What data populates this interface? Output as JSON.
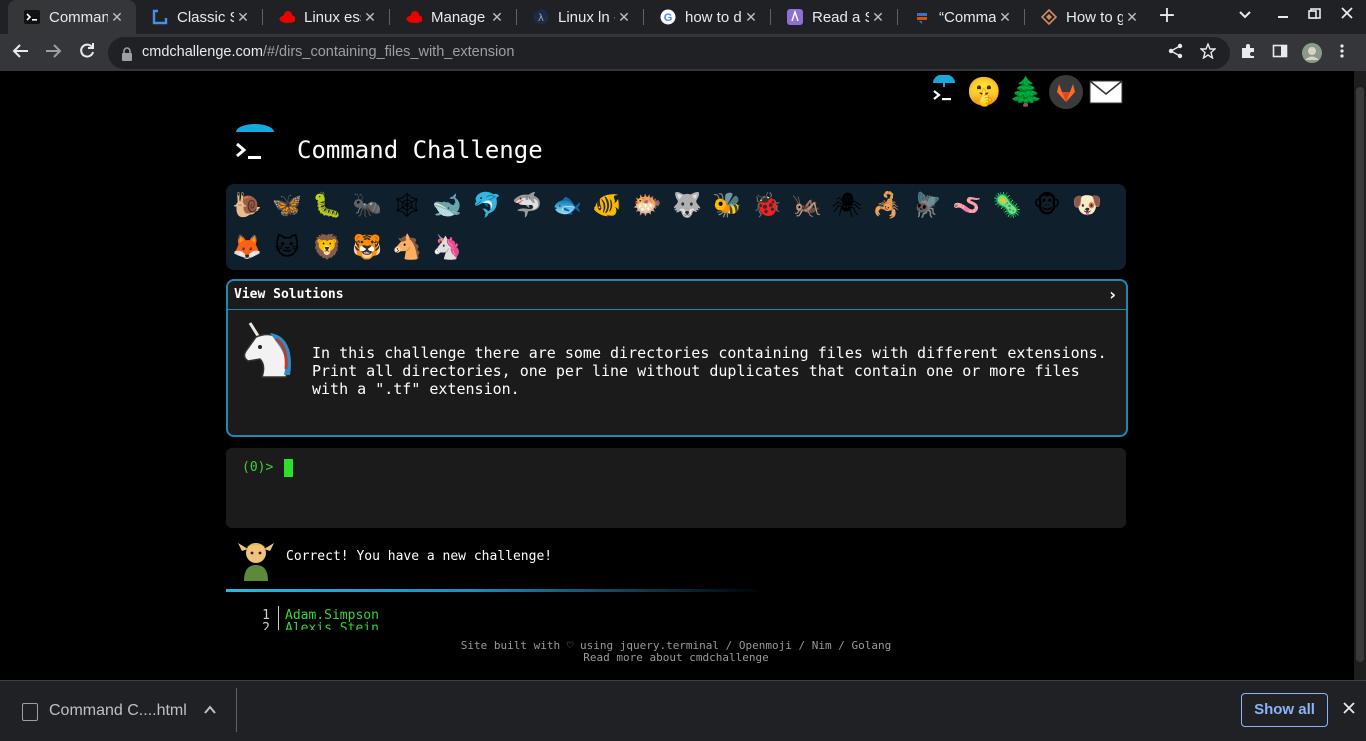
{
  "browser": {
    "tabs": [
      {
        "title": "Comman",
        "icon": "terminal-favicon",
        "active": true
      },
      {
        "title": "Classic Sy",
        "icon": "bracket-favicon"
      },
      {
        "title": "Linux ess",
        "icon": "redhat-favicon"
      },
      {
        "title": "Manage y",
        "icon": "redhat-favicon"
      },
      {
        "title": "Linux ln -",
        "icon": "lambda-favicon"
      },
      {
        "title": "how to d",
        "icon": "google-favicon"
      },
      {
        "title": "Read a Sp",
        "icon": "purple-favicon"
      },
      {
        "title": "“Comma",
        "icon": "stackexchange-favicon"
      },
      {
        "title": "How to g",
        "icon": "diamond-favicon"
      }
    ],
    "url_host": "cmdchallenge.com",
    "url_path": "/#/dirs_containing_files_with_extension",
    "new_tab": "+",
    "tab_close": "✕"
  },
  "page": {
    "site_title": "Command Challenge",
    "top_icons": [
      "terminal-icon",
      "hush-emoji-icon",
      "tree-icon",
      "gitlab-icon",
      "mail-icon"
    ],
    "animals": [
      {
        "name": "snail",
        "glyph": "🐌"
      },
      {
        "name": "butterfly",
        "glyph": "🦋"
      },
      {
        "name": "caterpillar",
        "glyph": "🐛"
      },
      {
        "name": "ant",
        "glyph": "🐜"
      },
      {
        "name": "spiderweb",
        "glyph": "🕸"
      },
      {
        "name": "whale",
        "glyph": "🐋"
      },
      {
        "name": "dolphin",
        "glyph": "🐬"
      },
      {
        "name": "shark",
        "glyph": "🦈"
      },
      {
        "name": "fish",
        "glyph": "🐟"
      },
      {
        "name": "tropical-fish",
        "glyph": "🐠"
      },
      {
        "name": "blowfish",
        "glyph": "🐡"
      },
      {
        "name": "wolf",
        "glyph": "🐺"
      },
      {
        "name": "bee",
        "glyph": "🐝"
      },
      {
        "name": "ladybug",
        "glyph": "🐞"
      },
      {
        "name": "cricket",
        "glyph": "🦗"
      },
      {
        "name": "spider",
        "glyph": "🕷"
      },
      {
        "name": "scorpion",
        "glyph": "🦂"
      },
      {
        "name": "fly",
        "glyph": "🪰"
      },
      {
        "name": "worm",
        "glyph": "🪱"
      },
      {
        "name": "microbe",
        "glyph": "🦠"
      },
      {
        "name": "monkey",
        "glyph": "🐵"
      },
      {
        "name": "dog",
        "glyph": "🐶"
      },
      {
        "name": "fox",
        "glyph": "🦊"
      },
      {
        "name": "cat",
        "glyph": "🐱"
      },
      {
        "name": "lion",
        "glyph": "🦁"
      },
      {
        "name": "tiger",
        "glyph": "🐯"
      },
      {
        "name": "horse",
        "glyph": "🐴"
      },
      {
        "name": "unicorn",
        "glyph": "🦄"
      }
    ],
    "solutions_label": "View Solutions",
    "solutions_chevron": "›",
    "challenge_text": "In this challenge there are some directories containing files with different extensions. Print all directories, one per line without duplicates that contain one or more files with a \".tf\" extension.",
    "prompt": "(0)>",
    "status_message": "Correct! You have a new challenge!",
    "output_lines": [
      {
        "num": "1",
        "text": "Adam.Simpson"
      },
      {
        "num": "2",
        "text": "Alexis.Stein"
      }
    ],
    "footer_line1": "Site built with ♡ using jquery.terminal / Openmoji / Nim / Golang",
    "footer_line2": "Read more about cmdchallenge"
  },
  "downloads": {
    "file_name": "Command C....html",
    "show_all": "Show all"
  },
  "colors": {
    "accent_blue": "#1d88b4",
    "terminal_green": "#3ad33a",
    "link_blue": "#8ab4f8"
  }
}
